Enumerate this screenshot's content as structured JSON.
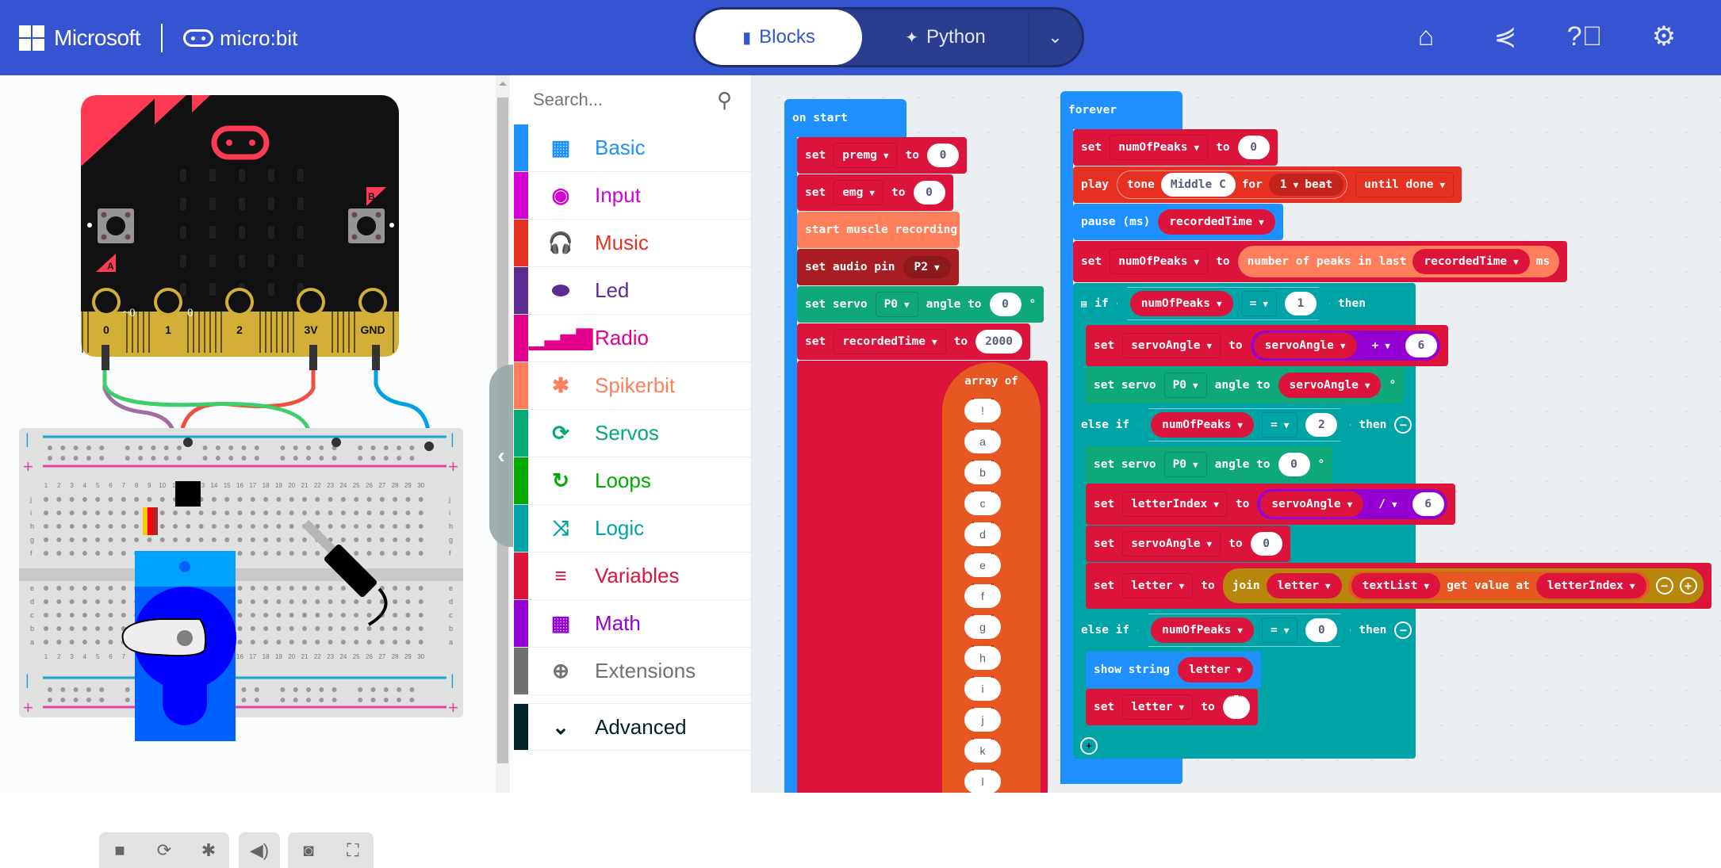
{
  "header": {
    "brand_ms": "Microsoft",
    "brand_mb": "micro:bit",
    "modes": [
      {
        "label": "Blocks",
        "icon": "puzzle-icon",
        "active": true
      },
      {
        "label": "Python",
        "icon": "python-icon",
        "active": false
      }
    ],
    "mode_dropdown_icon": "chevron-down-icon",
    "icons": [
      "home-icon",
      "share-icon",
      "help-icon",
      "settings-icon"
    ]
  },
  "simulator": {
    "board": {
      "buttons": [
        "A",
        "B"
      ],
      "pins": [
        "0",
        "1",
        "2",
        "3V",
        "GND"
      ],
      "pin_values": {
        "p0": "~0",
        "p1": "0"
      }
    },
    "breadboard": {
      "rows_top": [
        "j",
        "i",
        "h",
        "g",
        "f"
      ],
      "rows_bottom": [
        "e",
        "d",
        "c",
        "b",
        "a"
      ],
      "columns": 30
    },
    "controls": [
      {
        "name": "stop-icon",
        "glyph": "■"
      },
      {
        "name": "restart-icon",
        "glyph": "⟳"
      },
      {
        "name": "debug-icon",
        "glyph": "✱"
      },
      {
        "name": "mute-icon",
        "glyph": "🔊"
      },
      {
        "name": "screenshot-icon",
        "glyph": "◉"
      },
      {
        "name": "fullscreen-icon",
        "glyph": "⛶"
      }
    ]
  },
  "toolbox": {
    "search_placeholder": "Search...",
    "categories": [
      {
        "label": "Basic",
        "color": "#1e90ff",
        "glyph": "▦"
      },
      {
        "label": "Input",
        "color": "#d400d4",
        "glyph": "◉"
      },
      {
        "label": "Music",
        "color": "#e63022",
        "glyph": "🎧"
      },
      {
        "label": "Led",
        "color": "#5c2d91",
        "glyph": "⬬"
      },
      {
        "label": "Radio",
        "color": "#e3008c",
        "glyph": "▁▃▅▇"
      },
      {
        "label": "Spikerbit",
        "color": "#ff7f5c",
        "glyph": "✱"
      },
      {
        "label": "Servos",
        "color": "#03aa74",
        "glyph": "⟳"
      },
      {
        "label": "Loops",
        "color": "#00aa00",
        "glyph": "↻"
      },
      {
        "label": "Logic",
        "color": "#00a4a6",
        "glyph": "⤨"
      },
      {
        "label": "Variables",
        "color": "#dc143c",
        "glyph": "≡"
      },
      {
        "label": "Math",
        "color": "#9400d3",
        "glyph": "▦"
      },
      {
        "label": "Extensions",
        "color": "#717171",
        "glyph": "⊕"
      }
    ],
    "advanced": {
      "label": "Advanced",
      "color": "#002126",
      "glyph": "⌄"
    }
  },
  "workspace": {
    "on_start": {
      "title": "on start",
      "set1": {
        "kw": "set",
        "var": "premg",
        "to": "to",
        "val": "0"
      },
      "set2": {
        "kw": "set",
        "var": "emg",
        "to": "to",
        "val": "0"
      },
      "muscle": "start muscle recording",
      "audio": {
        "label": "set audio pin",
        "pin": "P2"
      },
      "servo": {
        "label": "set servo",
        "pin": "P0",
        "angle": "angle to",
        "val": "0",
        "deg": "°"
      },
      "set3": {
        "kw": "set",
        "var": "recordedTime",
        "to": "to",
        "val": "2000"
      },
      "array_label": "array of",
      "array_items": [
        "!",
        "a",
        "b",
        "c",
        "d",
        "e",
        "f",
        "g",
        "h",
        "i",
        "j",
        "k",
        "l"
      ]
    },
    "forever": {
      "title": "forever",
      "set_peaks": {
        "kw": "set",
        "var": "numOfPeaks",
        "to": "to",
        "val": "0"
      },
      "play": {
        "kw": "play",
        "tone": "tone",
        "note": "Middle C",
        "for": "for",
        "beats": "1",
        "beat": "beat",
        "mode": "until done"
      },
      "pause": {
        "label": "pause (ms)",
        "var": "recordedTime"
      },
      "set_peaks2": {
        "kw": "set",
        "var": "numOfPeaks",
        "to": "to",
        "expr": "number of peaks in last",
        "arg": "recordedTime",
        "unit": "ms"
      },
      "if1": {
        "kw": "if",
        "var": "numOfPeaks",
        "op": "=",
        "val": "1",
        "then": "then"
      },
      "set_angle": {
        "kw": "set",
        "var": "servoAngle",
        "to": "to",
        "lhs": "servoAngle",
        "op": "+",
        "rhs": "6"
      },
      "servo1": {
        "label": "set servo",
        "pin": "P0",
        "angle": "angle to",
        "var": "servoAngle",
        "deg": "°"
      },
      "elif2": {
        "kw": "else if",
        "var": "numOfPeaks",
        "op": "=",
        "val": "2",
        "then": "then"
      },
      "servo2": {
        "label": "set servo",
        "pin": "P0",
        "angle": "angle to",
        "val": "0",
        "deg": "°"
      },
      "set_index": {
        "kw": "set",
        "var": "letterIndex",
        "to": "to",
        "lhs": "servoAngle",
        "op": "/",
        "rhs": "6"
      },
      "set_angle0": {
        "kw": "set",
        "var": "servoAngle",
        "to": "to",
        "val": "0"
      },
      "set_letter": {
        "kw": "set",
        "var": "letter",
        "to": "to",
        "join": "join",
        "arg1": "letter",
        "list": "textList",
        "get": "get value at",
        "idx": "letterIndex"
      },
      "elif3": {
        "kw": "else if",
        "var": "numOfPeaks",
        "op": "=",
        "val": "0",
        "then": "then"
      },
      "show": {
        "label": "show string",
        "var": "letter"
      },
      "set_letter2": {
        "kw": "set",
        "var": "letter",
        "to": "to",
        "val": ""
      }
    }
  }
}
